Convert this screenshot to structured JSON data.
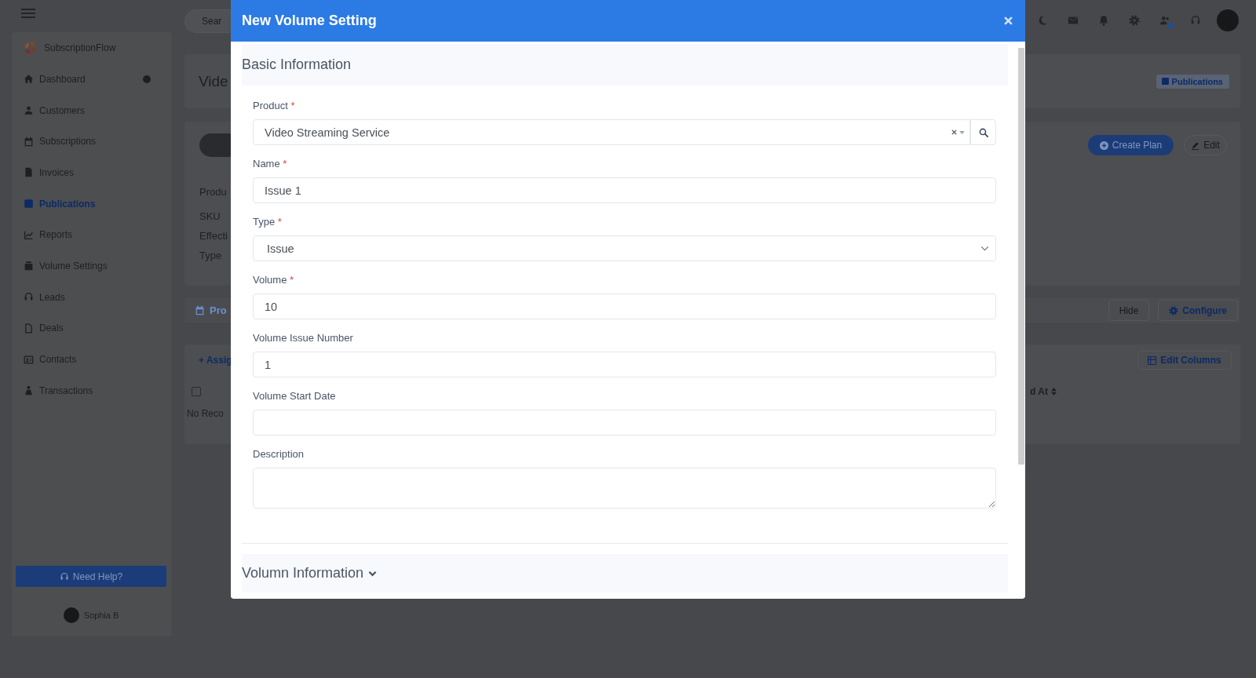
{
  "topbar": {
    "search": {
      "placeholder": "Sear"
    }
  },
  "sidebar": {
    "logo_text": "SubscriptionFlow",
    "items": [
      {
        "label": "Dashboard",
        "selected": false,
        "expandable": true
      },
      {
        "label": "Customers",
        "selected": false,
        "expandable": false
      },
      {
        "label": "Subscriptions",
        "selected": false,
        "expandable": false
      },
      {
        "label": "Invoices",
        "selected": false,
        "expandable": false
      },
      {
        "label": "Publications",
        "selected": true,
        "expandable": false
      },
      {
        "label": "Reports",
        "selected": false,
        "expandable": false
      },
      {
        "label": "Volume Settings",
        "selected": false,
        "expandable": false
      },
      {
        "label": "Leads",
        "selected": false,
        "expandable": false
      },
      {
        "label": "Deals",
        "selected": false,
        "expandable": false
      },
      {
        "label": "Contacts",
        "selected": false,
        "expandable": false
      },
      {
        "label": "Transactions",
        "selected": false,
        "expandable": false
      }
    ],
    "help_button": "Need Help?",
    "user": {
      "name": "Sophia B"
    }
  },
  "page": {
    "title": "Vide",
    "badge": "Publications",
    "actions": [
      {
        "label": "Create Plan",
        "kind": "primary"
      },
      {
        "label": "Edit",
        "kind": "outline"
      }
    ],
    "details": [
      "Produ",
      "SKU",
      "Effecti",
      "Type"
    ],
    "tabs": [
      {
        "label": "Pro",
        "selected": true
      }
    ],
    "tab_actions": [
      {
        "label": "Hide",
        "kind": "plain"
      },
      {
        "label": "Configure",
        "kind": "icon"
      }
    ],
    "table": {
      "assign_link": "+ Assig",
      "edit_columns": "Edit Columns",
      "select_all": {
        "checked": false
      },
      "columns": [
        "d At"
      ],
      "empty_text": "No Reco"
    }
  },
  "modal": {
    "title": "New Volume Setting",
    "sections": [
      {
        "title": "Basic Information",
        "expanded": true,
        "fields": [
          {
            "kind": "select-search",
            "label": "Product",
            "required_mark": "*",
            "value": "Video Streaming Service"
          },
          {
            "kind": "text",
            "label": "Name",
            "required_mark": "*",
            "value": "Issue 1"
          },
          {
            "kind": "select",
            "label": "Type",
            "required_mark": "*",
            "value": "Issue"
          },
          {
            "kind": "text",
            "label": "Volume",
            "required_mark": "*",
            "value": "10"
          },
          {
            "kind": "text",
            "label": "Volume Issue Number",
            "value": "1"
          },
          {
            "kind": "date",
            "label": "Volume Start Date"
          },
          {
            "kind": "textarea",
            "label": "Description"
          }
        ]
      },
      {
        "title": "Volumn Information",
        "expanded": false
      }
    ]
  }
}
